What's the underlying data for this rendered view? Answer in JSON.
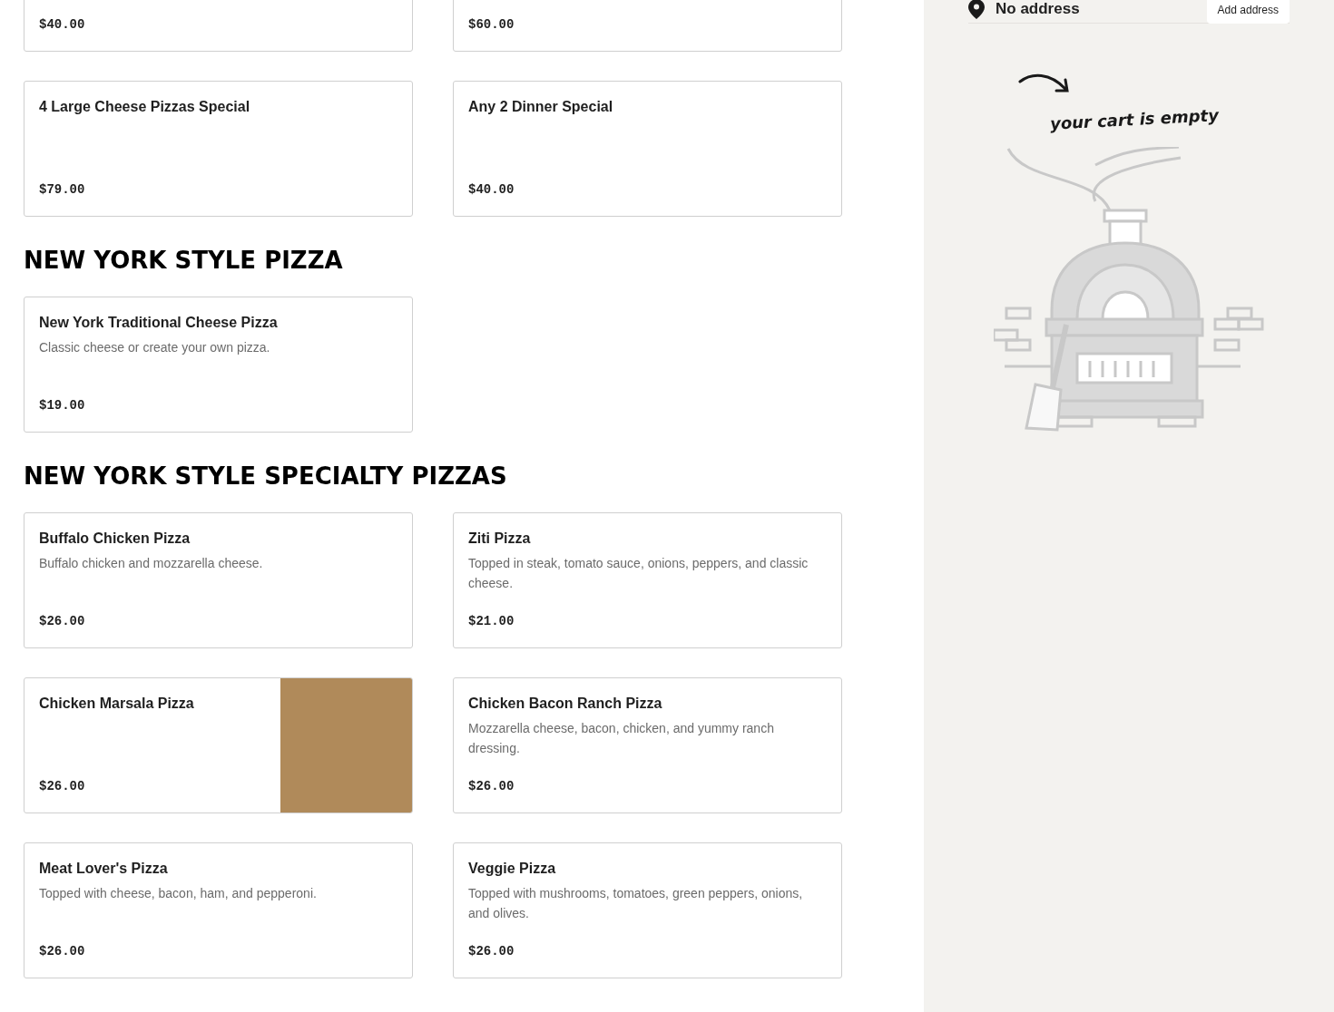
{
  "menu": {
    "sections": [
      {
        "items": [
          {
            "price": "$40.00",
            "photo": false
          },
          {
            "price": "$60.00",
            "photo": false
          },
          {
            "name": "4 Large Cheese Pizzas Special",
            "price": "$79.00",
            "photo": false
          },
          {
            "name": "Any 2 Dinner Special",
            "price": "$40.00",
            "photo": false
          }
        ]
      },
      {
        "title": "NEW YORK STYLE PIZZA",
        "items": [
          {
            "name": "New York Traditional Cheese Pizza",
            "description": "Classic cheese or create your own pizza.",
            "price": "$19.00",
            "photo": false
          }
        ]
      },
      {
        "title": "NEW YORK STYLE SPECIALTY PIZZAS",
        "items": [
          {
            "name": "Buffalo Chicken Pizza",
            "description": "Buffalo chicken and mozzarella cheese.",
            "price": "$26.00",
            "photo": false
          },
          {
            "name": "Ziti Pizza",
            "description": "Topped in steak, tomato sauce, onions, peppers, and classic cheese.",
            "price": "$21.00",
            "photo": false
          },
          {
            "name": "Chicken Marsala Pizza",
            "price": "$26.00",
            "photo": true
          },
          {
            "name": "Chicken Bacon Ranch Pizza",
            "description": "Mozzarella cheese, bacon, chicken, and yummy ranch dressing.",
            "price": "$26.00",
            "photo": false
          },
          {
            "name": "Meat Lover's Pizza",
            "description": "Topped with cheese, bacon, ham, and pepperoni.",
            "price": "$26.00",
            "photo": false
          },
          {
            "name": "Veggie Pizza",
            "description": "Topped with mushrooms, tomatoes, green peppers, onions, and olives.",
            "price": "$26.00",
            "photo": false
          }
        ]
      }
    ]
  },
  "cart": {
    "address": "No address",
    "add_address_button": "Add address",
    "empty_message": "your cart is empty"
  }
}
